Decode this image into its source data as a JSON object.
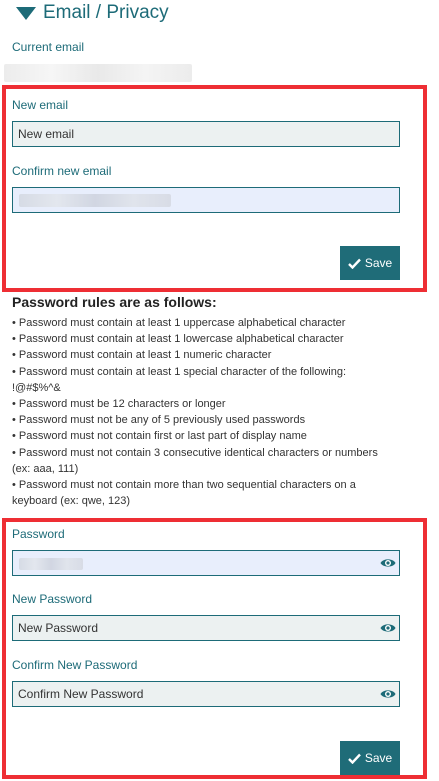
{
  "section": {
    "title": "Email / Privacy"
  },
  "email": {
    "current_label": "Current email",
    "new_label": "New email",
    "new_placeholder": "New email",
    "confirm_label": "Confirm new email",
    "save_label": "Save"
  },
  "rules": {
    "title": "Password rules are as follows:",
    "items": [
      "Password must contain at least 1 uppercase alphabetical character",
      "Password must contain at least 1 lowercase alphabetical character",
      "Password must contain at least 1 numeric character",
      "Password must contain at least 1 special character of the following: !@#$%^&",
      "Password must be 12 characters or longer",
      "Password must not be any of 5 previously used passwords",
      "Password must not contain first or last part of display name",
      "Password must not contain 3 consecutive identical characters or numbers (ex: aaa, 111)",
      "Password must not contain more than two sequential characters on a keyboard (ex: qwe, 123)"
    ]
  },
  "password": {
    "current_label": "Password",
    "new_label": "New Password",
    "new_placeholder": "New Password",
    "confirm_label": "Confirm New Password",
    "confirm_placeholder": "Confirm New Password",
    "save_label": "Save"
  },
  "colors": {
    "accent": "#1d6b78",
    "highlight_border": "#ee2e34",
    "button": "#1f6c78"
  },
  "icons": {
    "collapse": "triangle-down-icon",
    "visibility": "eye-icon",
    "save": "check-icon"
  }
}
